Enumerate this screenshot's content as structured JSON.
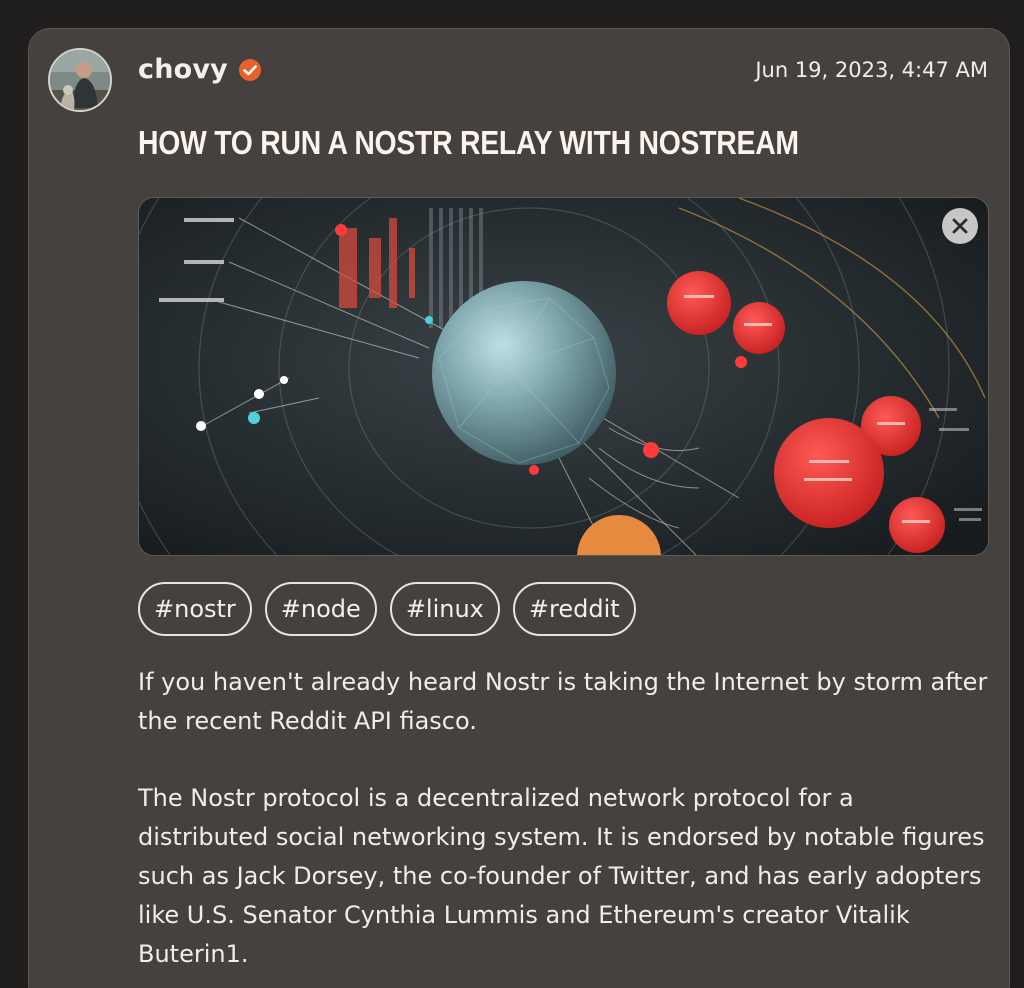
{
  "post": {
    "author": {
      "name": "chovy",
      "verified_icon": "verified-badge-icon",
      "avatar_icon": "avatar-photo"
    },
    "timestamp": "Jun 19, 2023, 4:47 AM",
    "title": "HOW TO RUN A NOSTR RELAY WITH NOSTREAM",
    "hero_image": {
      "icon": "network-globe-illustration",
      "close_icon": "close-icon"
    },
    "tags": [
      "#nostr",
      "#node",
      "#linux",
      "#reddit"
    ],
    "paragraphs": [
      "If you haven't already heard Nostr is taking the Internet by storm after the recent Reddit API fiasco.",
      "The Nostr protocol is a decentralized network protocol for a distributed social networking system. It is endorsed by notable figures such as Jack Dorsey, the co-founder of Twitter, and has early adopters like U.S. Senator Cynthia Lummis and Ethereum's creator Vitalik Buterin1."
    ]
  },
  "colors": {
    "page_bg": "#1f1e1d",
    "card_bg": "#45413e",
    "accent_orange": "#e8612c",
    "text": "#f1ede8"
  }
}
